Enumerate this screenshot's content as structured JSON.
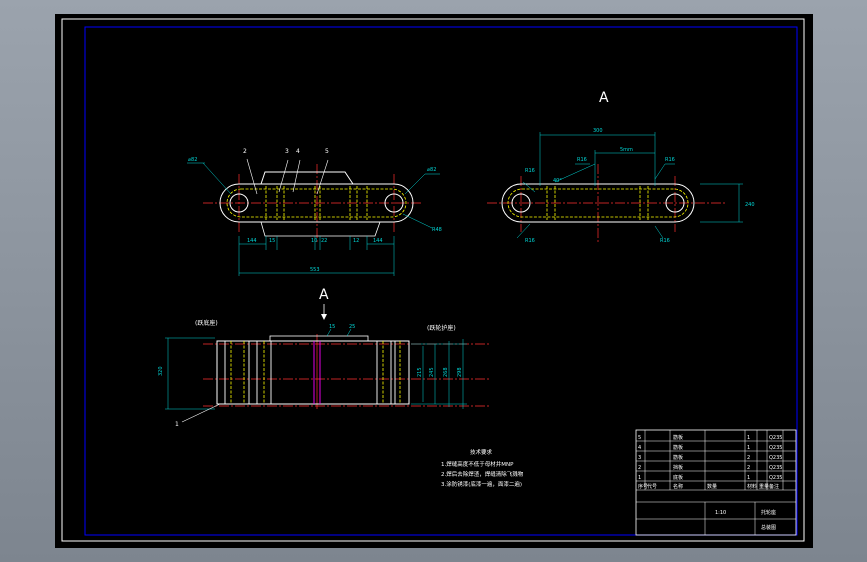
{
  "view_a_title": "A",
  "section_marker": "A",
  "balloons": [
    "1",
    "2",
    "3",
    "4",
    "5"
  ],
  "top_view_dims": {
    "hole_left": "⌀82",
    "hole_right": "⌀82",
    "overall": "553",
    "d1": "144",
    "d2": "15",
    "d3": "10",
    "d4": "22",
    "d5": "12",
    "d6": "144",
    "radius": "R48"
  },
  "view_a_dims": {
    "width": "300",
    "inner": "5mm",
    "height": "240",
    "r1": "R16",
    "r2": "R16",
    "r3": "R16",
    "r4": "R16",
    "r5": "R16",
    "angle": "40°"
  },
  "front_view": {
    "left_caption": "(跃底座)",
    "right_caption": "(跃轮护座)",
    "height_left": "320",
    "heights_right": [
      "215",
      "245",
      "268",
      "298"
    ],
    "top_dims": [
      "15",
      "25"
    ]
  },
  "notes": {
    "title": "技术要求",
    "lines": [
      "1.焊缝高度不低于母材并MNP",
      "2.焊后去除焊渣，焊缝清除飞溅物",
      "3.涂防锈漆(底漆一遍，面漆二遍)"
    ]
  },
  "title_block": {
    "rows": [
      [
        "5",
        "",
        "筋板",
        "",
        "1",
        "",
        "Q235"
      ],
      [
        "4",
        "",
        "筋板",
        "",
        "1",
        "",
        "Q235"
      ],
      [
        "3",
        "",
        "筋板",
        "",
        "2",
        "",
        "Q235"
      ],
      [
        "2",
        "",
        "挡板",
        "",
        "2",
        "",
        "Q235"
      ],
      [
        "1",
        "",
        "底板",
        "",
        "1",
        "",
        "Q235"
      ]
    ],
    "header": [
      "序号",
      "代号",
      "名称",
      "数量",
      "材料",
      "重量",
      "备注"
    ],
    "drawing_title": "托轮座",
    "subtitle": "总装图",
    "scale": "1:10"
  },
  "colors": {
    "frame": "#ffffff",
    "border": "#0000ff",
    "outline": "#ffffff",
    "hidden": "#ffff00",
    "centerline": "#ff3030",
    "dimension": "#00d8d8",
    "section": "#ff00ff"
  }
}
